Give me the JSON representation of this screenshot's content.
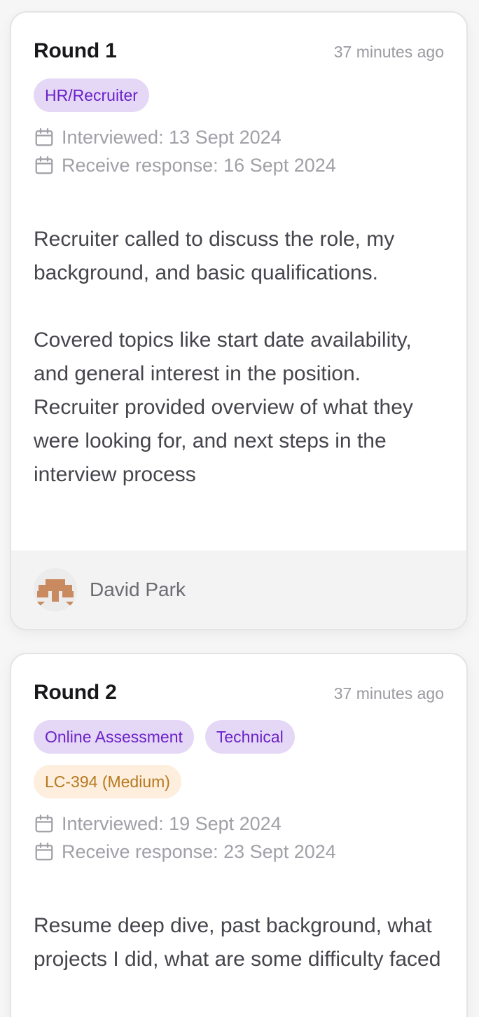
{
  "rounds": [
    {
      "title": "Round 1",
      "timestamp": "37 minutes ago",
      "tags": [
        {
          "label": "HR/Recruiter",
          "color": "purple"
        }
      ],
      "interviewed": "Interviewed: 13 Sept 2024",
      "response": "Receive response: 16 Sept 2024",
      "paragraphs": [
        "Recruiter called to discuss the role, my background, and basic qualifications.",
        "",
        "Covered topics like start date availability, and general interest in the position.",
        "Recruiter provided overview of what they were looking for, and next steps in the interview process"
      ],
      "author": "David Park"
    },
    {
      "title": "Round 2",
      "timestamp": "37 minutes ago",
      "tags": [
        {
          "label": "Online Assessment",
          "color": "purple"
        },
        {
          "label": "Technical",
          "color": "purple"
        },
        {
          "label": "LC-394 (Medium)",
          "color": "orange"
        }
      ],
      "interviewed": "Interviewed: 19 Sept 2024",
      "response": "Receive response: 23 Sept 2024",
      "paragraphs": [
        "Resume deep dive, past background, what projects I did, what are some difficulty faced"
      ]
    }
  ],
  "icons": {
    "calendar": "calendar-icon",
    "avatar": "identicon-avatar"
  },
  "colors": {
    "tag_purple_bg": "#e5d8f6",
    "tag_purple_text": "#6b21c8",
    "tag_orange_bg": "#fdeedd",
    "tag_orange_text": "#b7791f",
    "avatar_brown": "#c98a5f"
  }
}
